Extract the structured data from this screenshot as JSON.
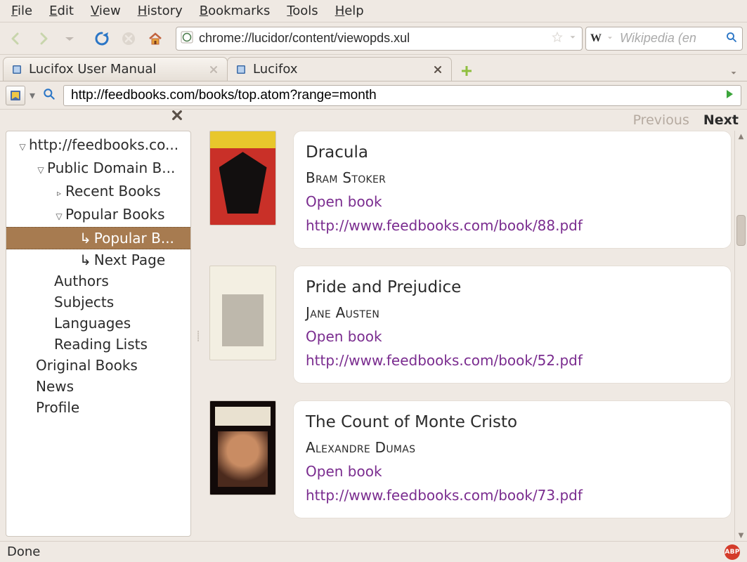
{
  "menu": {
    "file": "File",
    "edit": "Edit",
    "view": "View",
    "history": "History",
    "bookmarks": "Bookmarks",
    "tools": "Tools",
    "help": "Help"
  },
  "toolbar": {
    "url": "chrome://lucidor/content/viewopds.xul",
    "search_placeholder": "Wikipedia (en",
    "search_engine_label": "W"
  },
  "tabs": {
    "t0": {
      "label": "Lucifox User Manual"
    },
    "t1": {
      "label": "Lucifox"
    }
  },
  "feedbar": {
    "url": "http://feedbooks.com/books/top.atom?range=month"
  },
  "pager": {
    "prev": "Previous",
    "next": "Next"
  },
  "tree": {
    "root": "http://feedbooks.co...",
    "public": "Public Domain B...",
    "recent": "Recent Books",
    "popular": "Popular Books",
    "popularb": "Popular B...",
    "nextpage": "Next Page",
    "authors": "Authors",
    "subjects": "Subjects",
    "languages": "Languages",
    "readinglists": "Reading Lists",
    "original": "Original Books",
    "news": "News",
    "profile": "Profile"
  },
  "open_label": "Open book",
  "books": [
    {
      "title": "Dracula",
      "author": "Bram Stoker",
      "url": "http://www.feedbooks.com/book/88.pdf",
      "cover": "dracula"
    },
    {
      "title": "Pride and Prejudice",
      "author": "Jane Austen",
      "url": "http://www.feedbooks.com/book/52.pdf",
      "cover": "pride"
    },
    {
      "title": "The Count of Monte Cristo",
      "author": "Alexandre Dumas",
      "url": "http://www.feedbooks.com/book/73.pdf",
      "cover": "monte"
    }
  ],
  "status": {
    "text": "Done",
    "abp": "ABP"
  }
}
